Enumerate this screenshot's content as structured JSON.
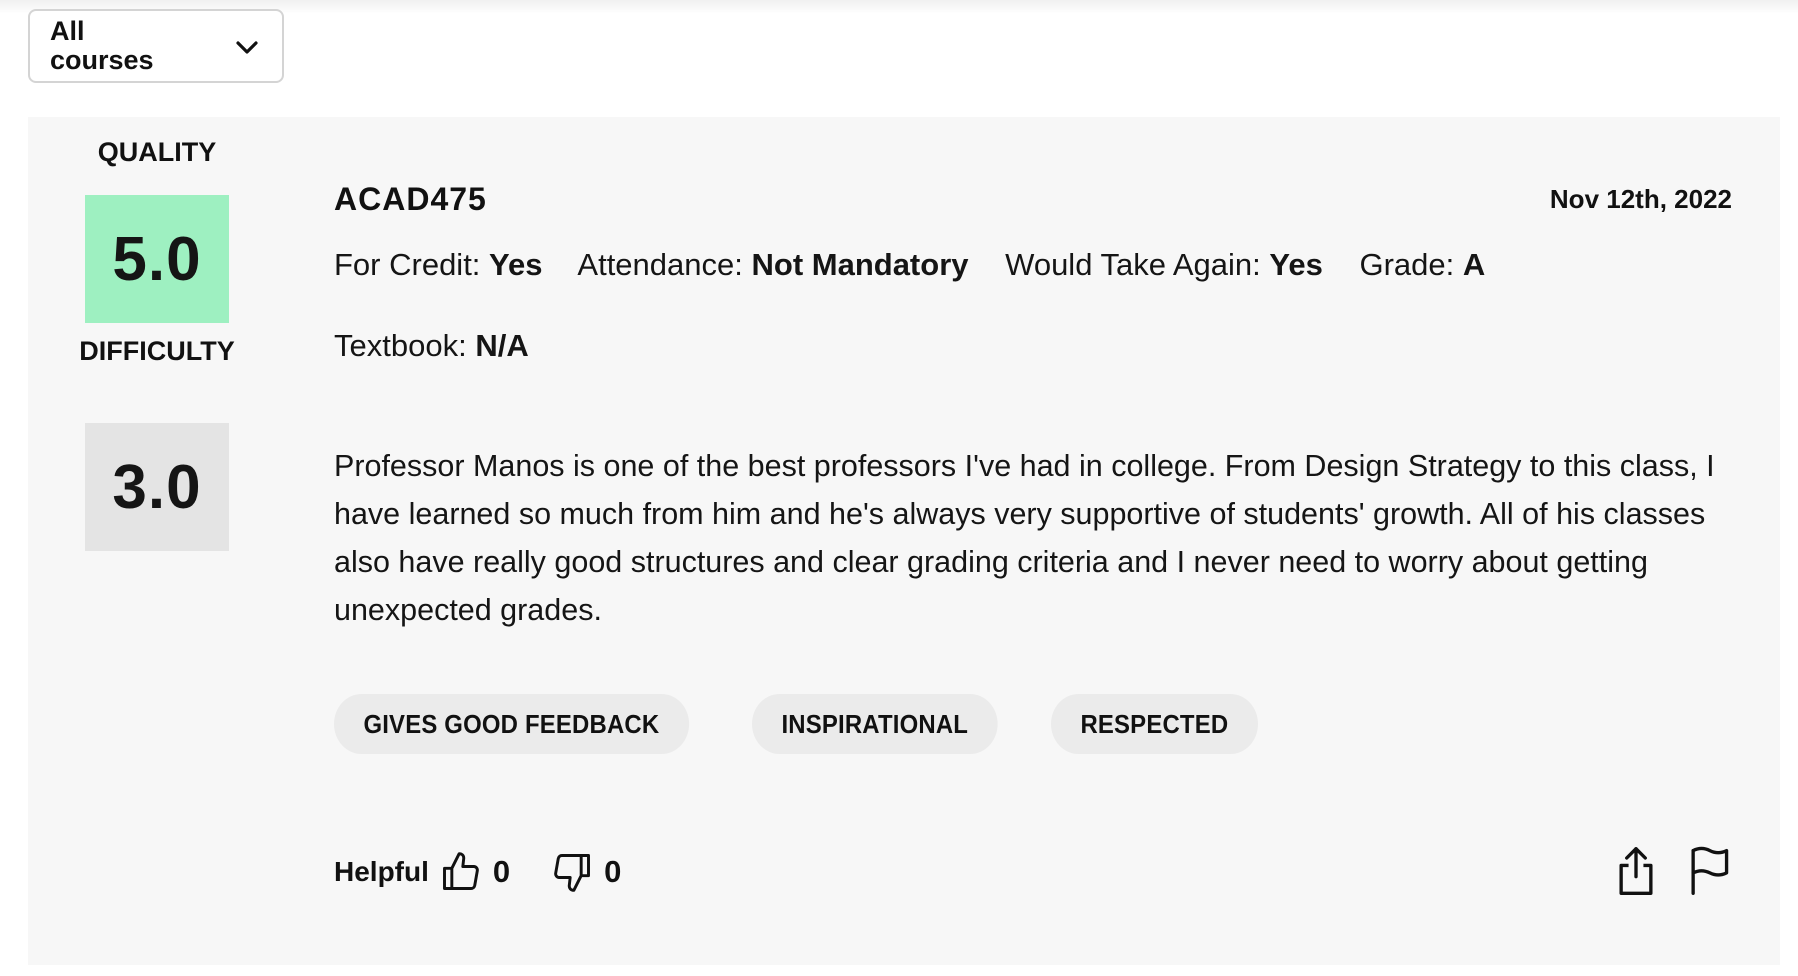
{
  "filter": {
    "selected": "All courses",
    "icon": "chevron-down-icon"
  },
  "rating": {
    "quality_label": "QUALITY",
    "quality_value": "5.0",
    "quality_color": "#9ef0c1",
    "difficulty_label": "DIFFICULTY",
    "difficulty_value": "3.0",
    "difficulty_color": "#e4e4e4"
  },
  "review": {
    "course": "ACAD475",
    "date": "Nov 12th, 2022",
    "meta": {
      "for_credit_label": "For Credit:",
      "for_credit_value": "Yes",
      "attendance_label": "Attendance:",
      "attendance_value": "Not Mandatory",
      "take_again_label": "Would Take Again:",
      "take_again_value": "Yes",
      "grade_label": "Grade:",
      "grade_value": "A",
      "textbook_label": "Textbook:",
      "textbook_value": "N/A"
    },
    "text": "Professor Manos is one of the best professors I've had in college. From Design Strategy to this class, I have learned so much from him and he's always very supportive of students' growth. All of his classes also have really good structures and clear grading criteria and I never need to worry about getting unexpected grades.",
    "tags": [
      "GIVES GOOD FEEDBACK",
      "INSPIRATIONAL",
      "RESPECTED"
    ]
  },
  "feedback": {
    "helpful_label": "Helpful",
    "thumbs_up_count": "0",
    "thumbs_down_count": "0",
    "icons": [
      "thumbs-up-icon",
      "thumbs-down-icon",
      "share-icon",
      "flag-icon"
    ]
  }
}
